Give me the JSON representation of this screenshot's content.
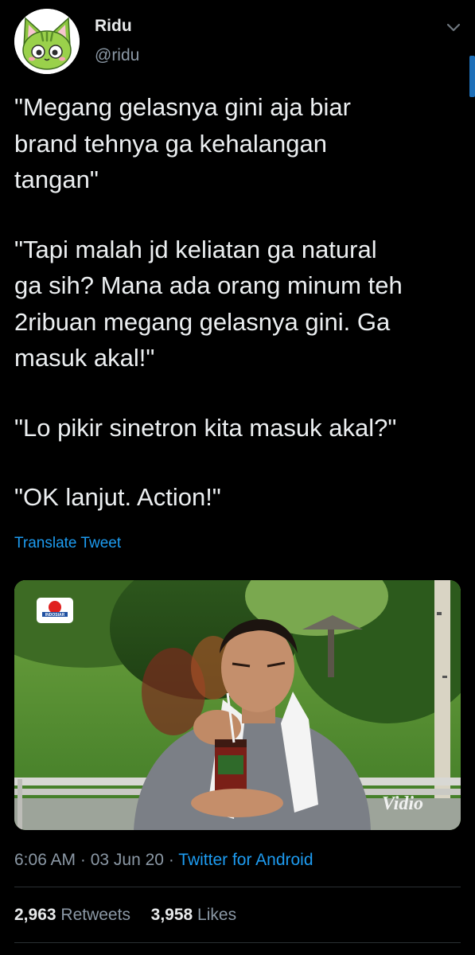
{
  "author": {
    "name": "Ridu",
    "handle": "@ridu",
    "avatar_icon": "cat-avatar-icon",
    "menu_icon": "chevron-down-icon"
  },
  "tweet": {
    "paragraphs": [
      "\"Megang gelasnya gini aja biar\nbrand tehnya ga kehalangan\ntangan\"",
      "\"Tapi malah jd keliatan ga natural\nga sih? Mana ada orang minum teh\n2ribuan megang gelasnya gini. Ga\nmasuk akal!\"",
      "\"Lo pikir sinetron kita masuk akal?\"",
      "\"OK lanjut. Action!\""
    ],
    "translate_label": "Translate Tweet"
  },
  "media": {
    "channel_logo_text": "INDOSIAR",
    "watermark_text": "Vidio"
  },
  "meta": {
    "time": "6:06 AM",
    "separator": " · ",
    "date": "03 Jun 20",
    "source": "Twitter for Android"
  },
  "stats": {
    "retweets_count": "2,963",
    "retweets_label": "Retweets",
    "likes_count": "3,958",
    "likes_label": "Likes"
  },
  "colors": {
    "background": "#000000",
    "text": "#e7e9ea",
    "secondary_text": "#8b98a5",
    "link": "#1d9bf0"
  }
}
